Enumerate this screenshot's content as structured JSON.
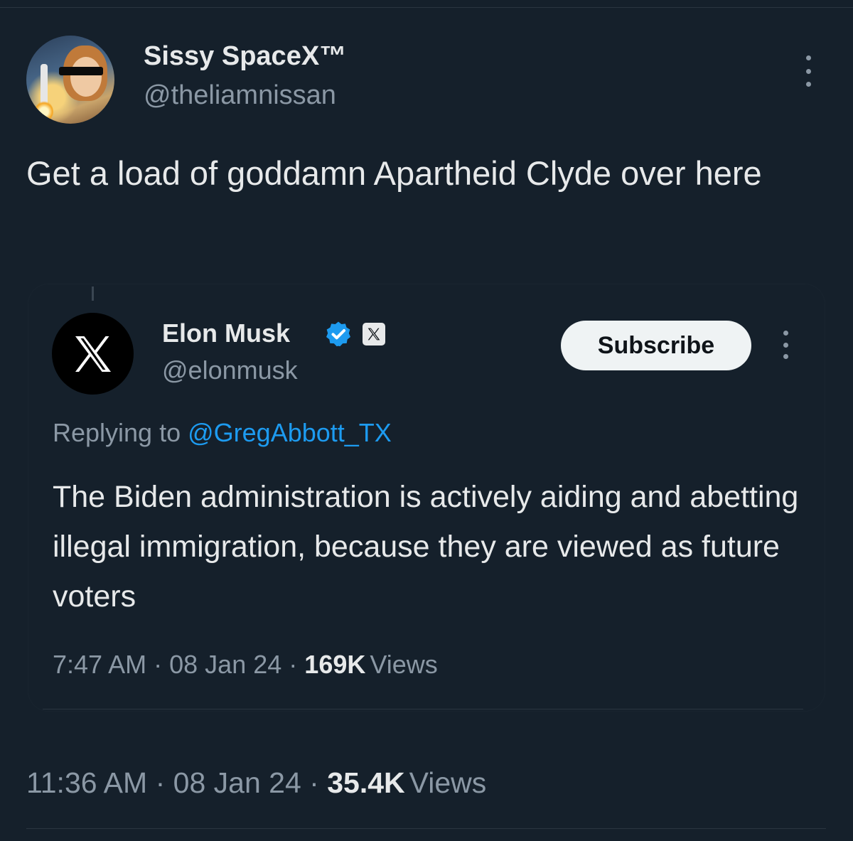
{
  "tweet": {
    "display_name": "Sissy SpaceX™",
    "handle": "@theliamnissan",
    "text": "Get a load of goddamn Apartheid Clyde over here",
    "time": "11:36 AM",
    "date": "08 Jan 24",
    "views_count": "35.4K",
    "views_label": "Views",
    "separator": "·"
  },
  "quoted": {
    "display_name": "Elon Musk",
    "handle": "@elonmusk",
    "subscribe_label": "Subscribe",
    "replying_prefix": "Replying to",
    "replying_handle": "@GregAbbott_TX",
    "text": "The Biden administration is actively aiding and abetting illegal immigration, because they are viewed as future voters",
    "time": "7:47 AM",
    "date": "08 Jan 24",
    "views_count": "169K",
    "views_label": "Views",
    "separator": "·"
  },
  "icons": {
    "more": "more-vertical-icon",
    "verified": "verified-badge-icon",
    "x_logo": "x-logo-icon"
  },
  "colors": {
    "background": "#15202b",
    "text_primary": "#e7e9ea",
    "text_secondary": "#8b98a5",
    "link": "#1d9bf0",
    "verified": "#1d9bf0"
  }
}
